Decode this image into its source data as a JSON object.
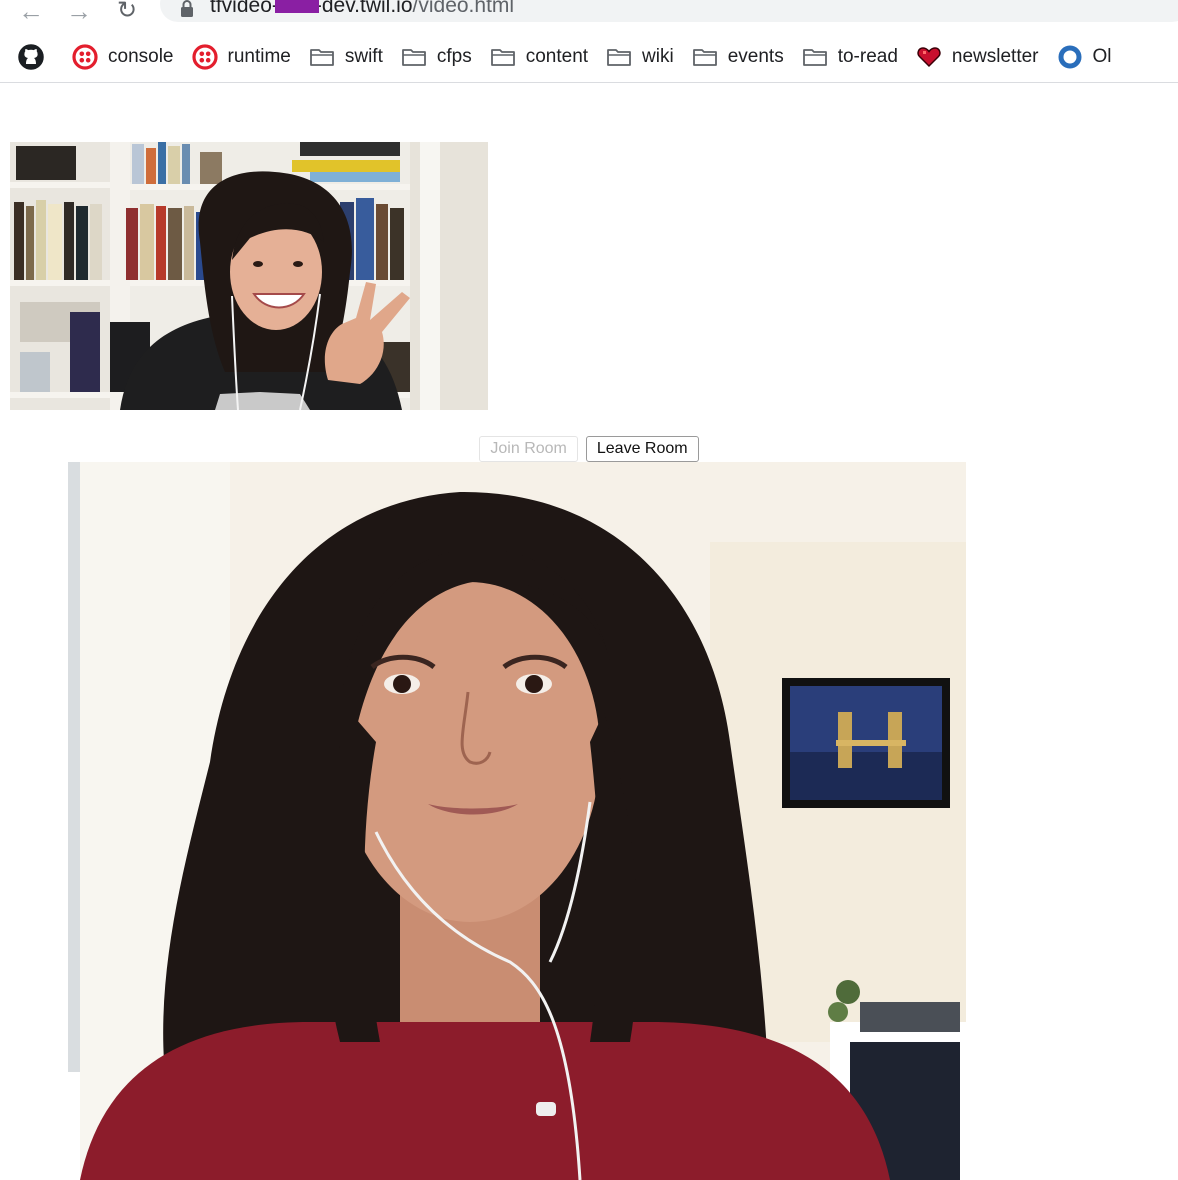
{
  "browser": {
    "url": {
      "host_prefix": "tfvideo-",
      "host_suffix": "-dev.twil.io",
      "path": "/video.html"
    },
    "bookmarks": [
      {
        "label": "",
        "icon": "github-icon"
      },
      {
        "label": "console",
        "icon": "twilio-icon"
      },
      {
        "label": "runtime",
        "icon": "twilio-icon"
      },
      {
        "label": "swift",
        "icon": "folder-icon"
      },
      {
        "label": "cfps",
        "icon": "folder-icon"
      },
      {
        "label": "content",
        "icon": "folder-icon"
      },
      {
        "label": "wiki",
        "icon": "folder-icon"
      },
      {
        "label": "events",
        "icon": "folder-icon"
      },
      {
        "label": "to-read",
        "icon": "folder-icon"
      },
      {
        "label": "newsletter",
        "icon": "heart-icon"
      },
      {
        "label": "Ol",
        "icon": "circle-icon"
      }
    ]
  },
  "controls": {
    "join_label": "Join Room",
    "leave_label": "Leave Room"
  },
  "colors": {
    "twilio_red": "#e31e2d",
    "heart_red": "#c8102e",
    "redaction": "#8a1fa3",
    "sweater": "#8c1c2b",
    "hair": "#1e1614"
  }
}
